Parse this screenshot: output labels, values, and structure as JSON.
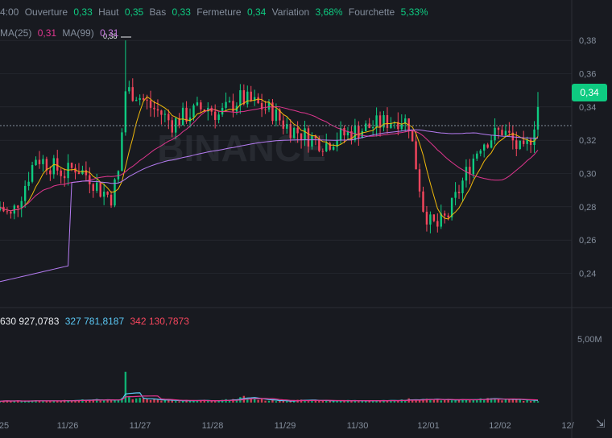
{
  "header": {
    "time_fragment": "4:00",
    "open_label": "Ouverture",
    "open_value": "0,33",
    "high_label": "Haut",
    "high_value": "0,35",
    "low_label": "Bas",
    "low_value": "0,33",
    "close_label": "Fermeture",
    "close_value": "0,34",
    "change_label": "Variation",
    "change_value": "3,68%",
    "range_label": "Fourchette",
    "range_value": "5,33%"
  },
  "ma_row": {
    "ma25_label": "MA(25)",
    "ma25_value": "0,31",
    "ma99_label": "MA(99)",
    "ma99_value": "0,31"
  },
  "volume_row": {
    "total": "630 927,0783",
    "ma_blue": "327 781,8187",
    "ma_red": "342 130,7873"
  },
  "price_tag": "0,34",
  "peak_label": "0,38",
  "watermark": "BINANCE",
  "colors": {
    "up": "#0ecb81",
    "down": "#f6465d",
    "ma7": "#f0b90b",
    "ma25": "#e0368f",
    "ma99": "#b57cf2",
    "grid": "#2b2f36",
    "bg": "#181a20"
  },
  "chart_data": {
    "type": "candlestick",
    "x_ticks": [
      "25",
      "11/26",
      "11/27",
      "11/28",
      "11/29",
      "11/30",
      "12/01",
      "12/02",
      "12/"
    ],
    "y_ticks": [
      "0,38",
      "0,36",
      "0,34",
      "0,32",
      "0,30",
      "0,28",
      "0,26",
      "0,24"
    ],
    "y_range": [
      0.2325,
      0.3825
    ],
    "volume_ticks": [
      "5,00M"
    ],
    "volume_max": 5000000,
    "current_price": 0.34,
    "peak_high": 0.38,
    "close_anchors": [
      [
        0,
        0.28
      ],
      [
        3,
        0.274
      ],
      [
        6,
        0.288
      ],
      [
        10,
        0.31
      ],
      [
        14,
        0.305
      ],
      [
        18,
        0.3
      ],
      [
        21,
        0.304
      ],
      [
        25,
        0.298
      ],
      [
        28,
        0.29
      ],
      [
        31,
        0.286
      ],
      [
        33,
        0.3
      ],
      [
        35,
        0.35
      ],
      [
        38,
        0.348
      ],
      [
        42,
        0.34
      ],
      [
        45,
        0.336
      ],
      [
        48,
        0.33
      ],
      [
        51,
        0.334
      ],
      [
        55,
        0.338
      ],
      [
        58,
        0.34
      ],
      [
        61,
        0.335
      ],
      [
        64,
        0.34
      ],
      [
        67,
        0.345
      ],
      [
        70,
        0.343
      ],
      [
        73,
        0.34
      ],
      [
        76,
        0.337
      ],
      [
        79,
        0.33
      ],
      [
        82,
        0.326
      ],
      [
        85,
        0.323
      ],
      [
        88,
        0.32
      ],
      [
        91,
        0.318
      ],
      [
        94,
        0.322
      ],
      [
        97,
        0.324
      ],
      [
        100,
        0.326
      ],
      [
        103,
        0.328
      ],
      [
        106,
        0.33
      ],
      [
        109,
        0.332
      ],
      [
        112,
        0.333
      ],
      [
        114,
        0.33
      ],
      [
        116,
        0.305
      ],
      [
        118,
        0.28
      ],
      [
        120,
        0.27
      ],
      [
        122,
        0.268
      ],
      [
        125,
        0.275
      ],
      [
        128,
        0.29
      ],
      [
        131,
        0.305
      ],
      [
        134,
        0.318
      ],
      [
        137,
        0.322
      ],
      [
        140,
        0.326
      ],
      [
        142,
        0.322
      ],
      [
        144,
        0.316
      ],
      [
        146,
        0.312
      ],
      [
        148,
        0.322
      ],
      [
        150,
        0.34
      ]
    ],
    "volume_anchors": [
      [
        0,
        120000
      ],
      [
        20,
        150000
      ],
      [
        34,
        300000
      ],
      [
        35,
        1800000
      ],
      [
        36,
        500000
      ],
      [
        38,
        300000
      ],
      [
        45,
        150000
      ],
      [
        65,
        200000
      ],
      [
        68,
        450000
      ],
      [
        75,
        180000
      ],
      [
        95,
        150000
      ],
      [
        110,
        160000
      ],
      [
        116,
        300000
      ],
      [
        120,
        250000
      ],
      [
        128,
        200000
      ],
      [
        135,
        350000
      ],
      [
        140,
        250000
      ],
      [
        150,
        160000
      ]
    ]
  }
}
